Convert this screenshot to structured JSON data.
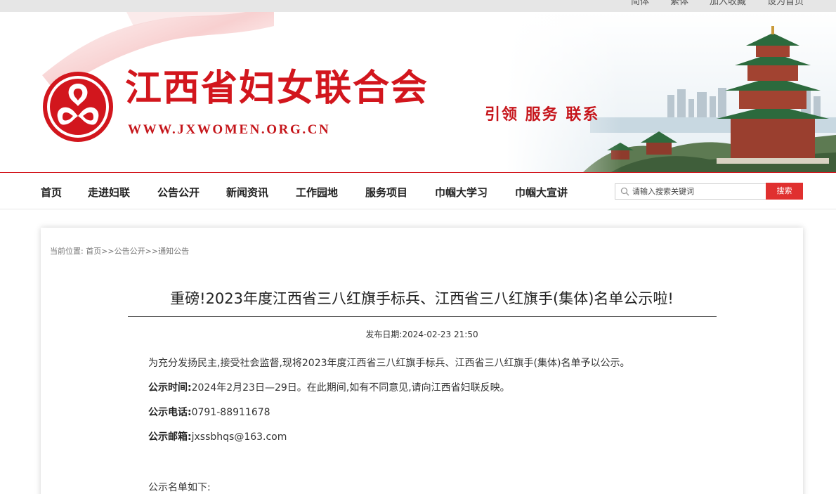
{
  "topbar": {
    "links": [
      "简体",
      "繁体",
      "加入收藏",
      "设为首页"
    ]
  },
  "header": {
    "site_name": "江西省妇女联合会",
    "site_url": "WWW.JXWOMEN.ORG.CN",
    "slogan": "引领 服务 联系",
    "brand_color": "#d2161d"
  },
  "nav": {
    "items": [
      "首页",
      "走进妇联",
      "公告公开",
      "新闻资讯",
      "工作园地",
      "服务项目",
      "巾帼大学习",
      "巾帼大宣讲"
    ],
    "search_placeholder": "请输入搜索关键词",
    "search_button": "搜索",
    "search_icon": "search-icon"
  },
  "breadcrumb": {
    "prefix": "当前位置:",
    "parts": [
      "首页",
      ">>",
      "公告公开",
      ">>",
      "通知公告"
    ]
  },
  "article": {
    "title": "重磅!2023年度江西省三八红旗手标兵、江西省三八红旗手(集体)名单公示啦!",
    "pubdate": "发布日期:2024-02-23 21:50",
    "intro": "为充分发扬民主,接受社会监督,现将2023年度江西省三八红旗手标兵、江西省三八红旗手(集体)名单予以公示。",
    "time_label": "公示时间:",
    "time_value": "2024年2月23日—29日。在此期间,如有不同意见,请向江西省妇联反映。",
    "phone_label": "公示电话:",
    "phone_value": "0791-88911678",
    "email_label": "公示邮箱:",
    "email_value": "jxssbhqs@163.com",
    "list_heading": "公示名单如下:"
  }
}
